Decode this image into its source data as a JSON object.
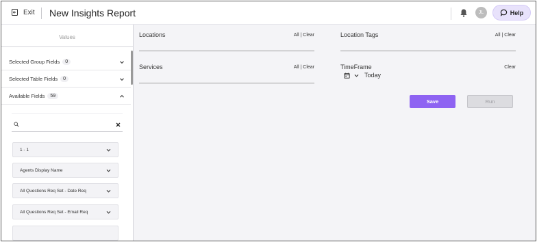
{
  "header": {
    "exit_label": "Exit",
    "title": "New Insights Report",
    "avatar_initials": "JL",
    "help_label": "Help"
  },
  "sidebar": {
    "values_label": "Values",
    "sections": [
      {
        "label": "Selected Group Fields",
        "count": "0"
      },
      {
        "label": "Selected Table Fields",
        "count": "0"
      },
      {
        "label": "Available Fields",
        "count": "59"
      }
    ],
    "search": {
      "value": "",
      "placeholder": ""
    },
    "fields": [
      "1 - 1",
      "Agents Display Name",
      "All Questions Req Set - Date Req",
      "All Questions Req Set - Email Req"
    ]
  },
  "filters": {
    "locations": {
      "label": "Locations",
      "all": "All",
      "sep": "|",
      "clear": "Clear"
    },
    "location_tags": {
      "label": "Location Tags",
      "all": "All",
      "sep": "|",
      "clear": "Clear"
    },
    "services": {
      "label": "Services",
      "all": "All",
      "sep": "|",
      "clear": "Clear"
    },
    "timeframe": {
      "label": "TimeFrame",
      "clear": "Clear",
      "value": "Today"
    }
  },
  "actions": {
    "save_label": "Save",
    "run_label": "Run"
  },
  "colors": {
    "accent": "#8e63f2",
    "help_bg": "#e8e2fb",
    "main_bg": "#f4f4f7"
  }
}
